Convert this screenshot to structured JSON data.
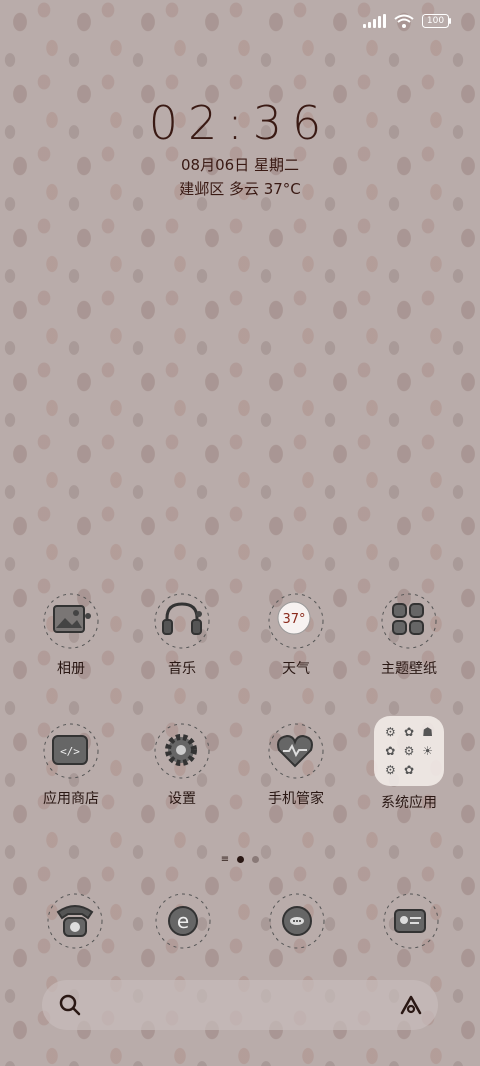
{
  "status": {
    "battery": "100"
  },
  "lockinfo": {
    "time": "02:36",
    "date": "08月06日 星期二",
    "weather": "建邺区 多云 37°C"
  },
  "apps": [
    {
      "label": "相册",
      "icon": "gallery-icon"
    },
    {
      "label": "音乐",
      "icon": "headphones-icon"
    },
    {
      "label": "天气",
      "icon": "weather-icon",
      "temp": "37°"
    },
    {
      "label": "主题壁纸",
      "icon": "theme-icon"
    },
    {
      "label": "应用商店",
      "icon": "app-store-icon"
    },
    {
      "label": "设置",
      "icon": "gear-icon"
    },
    {
      "label": "手机管家",
      "icon": "security-heart-icon"
    },
    {
      "label": "系统应用",
      "icon": "folder-icon"
    }
  ],
  "dock": [
    {
      "icon": "phone-icon"
    },
    {
      "icon": "browser-icon"
    },
    {
      "icon": "messages-icon"
    },
    {
      "icon": "contacts-card-icon"
    }
  ],
  "search": {
    "placeholder": ""
  },
  "colors": {
    "text": "#3a1a14",
    "background": "#b9acaa"
  }
}
